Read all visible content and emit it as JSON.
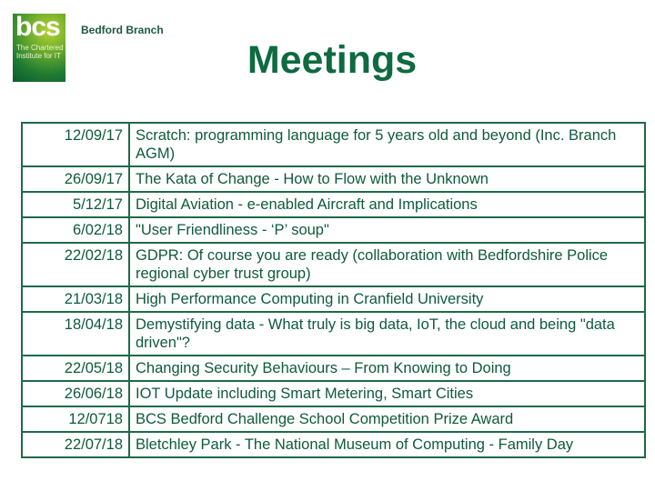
{
  "logo": {
    "text": "bcs",
    "subtitle": "The Chartered Institute for IT",
    "brand_color": "#1f7a33"
  },
  "branch": "Bedford Branch",
  "title": "Meetings",
  "meetings": [
    {
      "date": "12/09/17",
      "topic": "Scratch: programming language for 5 years old and beyond (Inc. Branch AGM)"
    },
    {
      "date": "26/09/17",
      "topic": "The Kata of Change - How to Flow with the Unknown"
    },
    {
      "date": "5/12/17",
      "topic": "Digital Aviation - e-enabled Aircraft and Implications"
    },
    {
      "date": "6/02/18",
      "topic": "\"User Friendliness - ‘P’ soup\""
    },
    {
      "date": "22/02/18",
      "topic": "GDPR: Of course you are ready (collaboration with Bedfordshire Police regional cyber trust group)"
    },
    {
      "date": "21/03/18",
      "topic": "High Performance Computing in Cranfield University"
    },
    {
      "date": "18/04/18",
      "topic": "Demystifying data - What truly is big data, IoT, the cloud and being \"data driven\"?"
    },
    {
      "date": "22/05/18",
      "topic": "Changing Security Behaviours – From Knowing to Doing"
    },
    {
      "date": "26/06/18",
      "topic": "IOT Update including Smart Metering, Smart Cities"
    },
    {
      "date": "12/0718",
      "topic": "BCS Bedford Challenge School Competition Prize Award"
    },
    {
      "date": "22/07/18",
      "topic": "Bletchley Park - The National Museum of Computing - Family Day"
    }
  ]
}
